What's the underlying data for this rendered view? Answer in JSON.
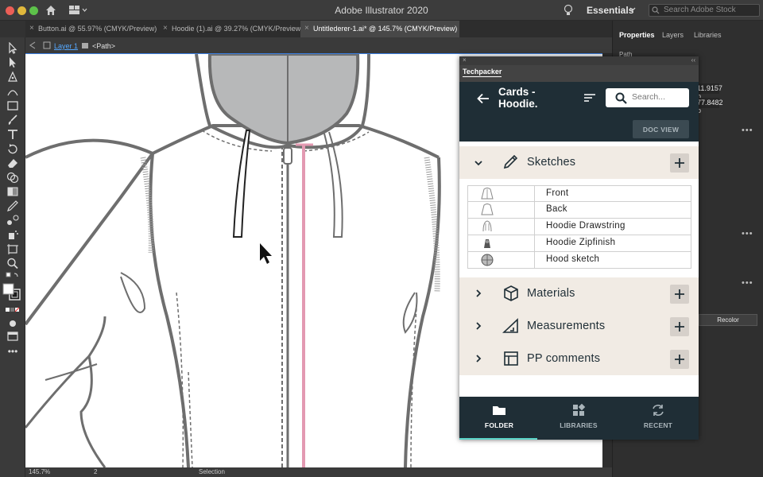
{
  "app": {
    "title": "Adobe Illustrator 2020",
    "workspace": "Essentials",
    "stock_search_placeholder": "Search Adobe Stock"
  },
  "tabs": [
    {
      "label": "Button.ai @ 55.97% (CMYK/Preview)"
    },
    {
      "label": "Hoodie (1).ai @ 39.27% (CMYK/Preview)"
    },
    {
      "label": "Untitlederer-1.ai* @ 145.7% (CMYK/Preview)",
      "active": true
    }
  ],
  "control_bar": {
    "layer": "Layer 1",
    "path": "<Path>"
  },
  "status_bar": {
    "zoom": "145.7%",
    "page": "2",
    "tool": "Selection"
  },
  "right_panel": {
    "tabs": [
      "Properties",
      "Layers",
      "Libraries"
    ],
    "section": "Path",
    "x_value": "11.9157 p",
    "y_value": "77.8482 p",
    "recolor_label": "Recolor"
  },
  "techpacker": {
    "panel_title": "Techpacker",
    "header_title": "Cards - Hoodie.",
    "search_placeholder": "Search...",
    "doc_view_label": "DOC VIEW",
    "sections": [
      {
        "label": "Sketches",
        "icon": "pencil-icon",
        "expanded": true
      },
      {
        "label": "Materials",
        "icon": "cube-icon",
        "expanded": false
      },
      {
        "label": "Measurements",
        "icon": "set-square-icon",
        "expanded": false
      },
      {
        "label": "PP comments",
        "icon": "layout-icon",
        "expanded": false
      }
    ],
    "sketches": [
      "Front",
      "Back",
      "Hoodie Drawstring",
      "Hoodie Zipfinish",
      "Hood sketch"
    ],
    "footer_nav": [
      {
        "label": "FOLDER",
        "icon": "folder-icon",
        "active": true
      },
      {
        "label": "LIBRARIES",
        "icon": "libraries-icon"
      },
      {
        "label": "RECENT",
        "icon": "refresh-icon"
      }
    ]
  },
  "colors": {
    "header_bg": "#1f2e36",
    "section_bg": "#f1ebe4",
    "zipper_pink": "#e39ab2",
    "hood_gray": "#b7b8b9",
    "active_accent": "#5ad4c8"
  }
}
